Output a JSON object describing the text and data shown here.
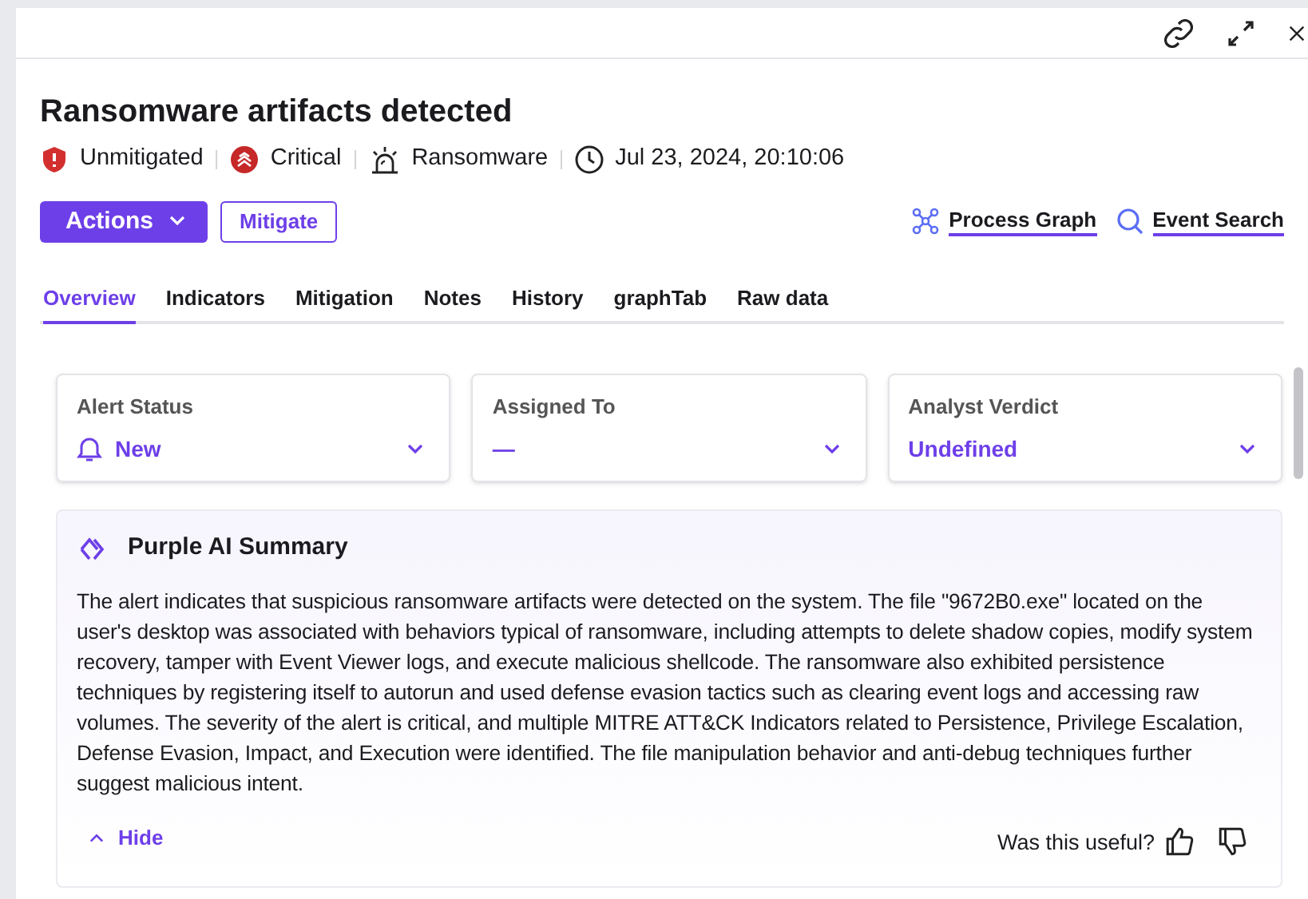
{
  "title": "Ransomware artifacts detected",
  "meta": [
    {
      "kind": "shield",
      "label": "Unmitigated"
    },
    {
      "kind": "severity",
      "label": "Critical"
    },
    {
      "kind": "alarm",
      "label": "Ransomware"
    },
    {
      "kind": "clock",
      "label": "Jul 23, 2024, 20:10:06"
    }
  ],
  "actions_button": "Actions",
  "mitigate_button": "Mitigate",
  "links": [
    {
      "kind": "graph",
      "label": "Process Graph"
    },
    {
      "kind": "search",
      "label": "Event Search"
    }
  ],
  "tabs": [
    {
      "label": "Overview",
      "selected": true
    },
    {
      "label": "Indicators",
      "selected": false
    },
    {
      "label": "Mitigation",
      "selected": false
    },
    {
      "label": "Notes",
      "selected": false
    },
    {
      "label": "History",
      "selected": false
    },
    {
      "label": "graphTab",
      "selected": false
    },
    {
      "label": "Raw data",
      "selected": false
    }
  ],
  "fields": [
    {
      "kind": "status",
      "label": "Alert Status",
      "value": "New"
    },
    {
      "kind": "plain",
      "label": "Assigned To",
      "value": "—"
    },
    {
      "kind": "plain",
      "label": "Analyst Verdict",
      "value": "Undefined"
    }
  ],
  "summary": {
    "title": "Purple AI Summary",
    "text": "The alert indicates that suspicious ransomware artifacts were detected on the system. The file \"9672B0.exe\" located on the user's desktop was associated with behaviors typical of ransomware, including attempts to delete shadow copies, modify system recovery, tamper with Event Viewer logs, and execute malicious shellcode. The ransomware also exhibited persistence techniques by registering itself to autorun and used defense evasion tactics such as clearing event logs and accessing raw volumes. The severity of the alert is critical, and multiple MITRE ATT&CK Indicators related to Persistence, Privilege Escalation, Defense Evasion, Impact, and Execution were identified. The file manipulation behavior and anti-debug techniques further suggest malicious intent.",
    "hide_button": "Hide",
    "feedback": "Was this useful?"
  }
}
